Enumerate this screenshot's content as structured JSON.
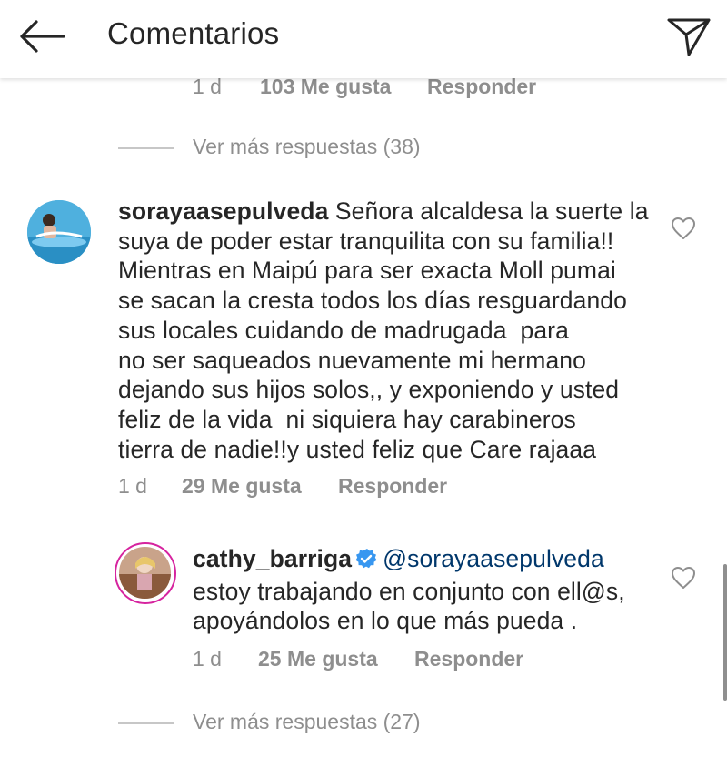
{
  "header": {
    "title": "Comentarios",
    "back_icon": "arrow-left-icon",
    "send_icon": "paper-plane-icon"
  },
  "comments": [
    {
      "time": "1 d",
      "likes": "103 Me gusta",
      "reply_label": "Responder",
      "more_replies": "Ver más respuestas (38)"
    },
    {
      "username": "sorayaasepulveda",
      "text": "Señora alcaldesa la suerte la\nsuya de poder estar tranquilita con su familia!!\nMientras en Maipú para ser exacta Moll pumai\nse sacan la cresta todos los días resguardando\nsus locales cuidando de madrugada  para\nno ser saqueados nuevamente mi hermano\ndejando sus hijos solos,, y exponiendo y usted\nfeliz de la vida  ni siquiera hay carabineros\ntierra de nadie!!y usted feliz que Care rajaaa",
      "time": "1 d",
      "likes": "29 Me gusta",
      "reply_label": "Responder",
      "replies": [
        {
          "username": "cathy_barriga",
          "verified": true,
          "mention": "@sorayaasepulveda",
          "text": "estoy trabajando en conjunto con ell@s,\napoyándolos en lo que más pueda .",
          "time": "1 d",
          "likes": "25 Me gusta",
          "reply_label": "Responder"
        }
      ],
      "more_replies": "Ver más respuestas (27)"
    }
  ],
  "colors": {
    "text": "#262626",
    "secondary": "#8e8e8e",
    "mention": "#00376b",
    "verified": "#3897f0",
    "avatar_ring": "#d6249f"
  }
}
